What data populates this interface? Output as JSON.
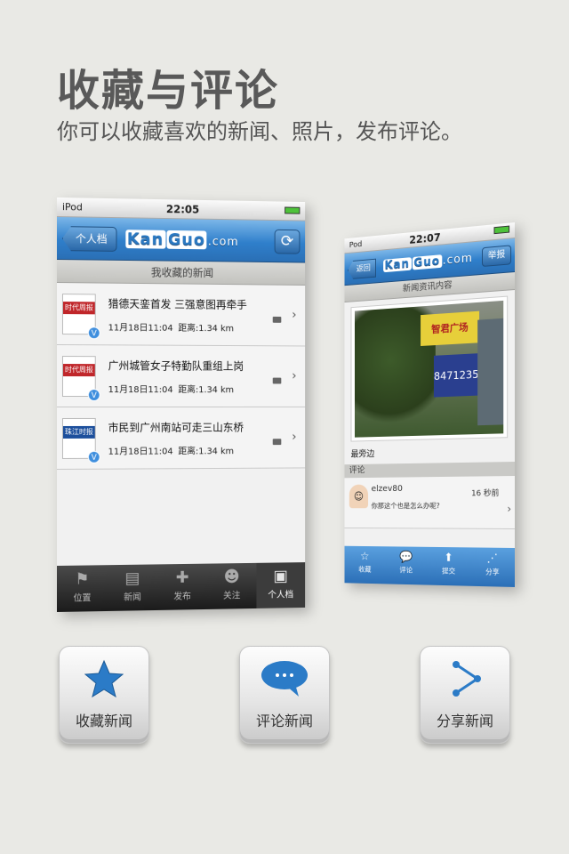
{
  "hero": {
    "title": "收藏与评论",
    "subtitle": "你可以收藏喜欢的新闻、照片，发布评论。"
  },
  "left_phone": {
    "status": {
      "carrier": "iPod",
      "time": "22:05"
    },
    "nav": {
      "back_label": "个人档",
      "logo_box": "Kan",
      "logo_box2": "Guo",
      "logo_dom": ".com"
    },
    "section_title": "我收藏的新闻",
    "news": [
      {
        "title": "猎德天銮首发 三强意图再牵手",
        "date": "11月18日11:04",
        "distance": "距离:1.34 km",
        "thumb": "时代周报"
      },
      {
        "title": "广州城管女子特勤队重组上岗",
        "date": "11月18日11:04",
        "distance": "距离:1.34 km",
        "thumb": "时代周报"
      },
      {
        "title": "市民到广州南站可走三山东桥",
        "date": "11月18日11:04",
        "distance": "距离:1.34 km",
        "thumb": "珠江时报"
      }
    ],
    "tabs": [
      {
        "label": "位置",
        "icon": "location-icon"
      },
      {
        "label": "新闻",
        "icon": "newspaper-icon"
      },
      {
        "label": "发布",
        "icon": "plus-icon"
      },
      {
        "label": "关注",
        "icon": "people-icon"
      },
      {
        "label": "个人档",
        "icon": "profile-card-icon"
      }
    ]
  },
  "right_phone": {
    "status": {
      "carrier": "Pod",
      "time": "22:07"
    },
    "nav": {
      "back_label": "返回",
      "report_label": "举报"
    },
    "section_title": "新闻资讯内容",
    "photo_signs": [
      "智君广场",
      "84712355"
    ],
    "caption": "最旁边",
    "comment_header": "评论",
    "comment": {
      "user": "elzev80",
      "time": "16 秒前",
      "text": "你那这个也是怎么办呢?"
    },
    "tabs": [
      {
        "label": "收藏",
        "icon": "star-icon"
      },
      {
        "label": "评论",
        "icon": "speech-icon"
      },
      {
        "label": "提交",
        "icon": "upload-icon"
      },
      {
        "label": "分享",
        "icon": "share-icon"
      }
    ]
  },
  "features": [
    {
      "label": "收藏新闻",
      "icon": "star-icon"
    },
    {
      "label": "评论新闻",
      "icon": "speech-bubble-icon"
    },
    {
      "label": "分享新闻",
      "icon": "share-icon"
    }
  ],
  "colors": {
    "accent_blue": "#2f7fcb",
    "page_bg": "#e9e9e5"
  }
}
